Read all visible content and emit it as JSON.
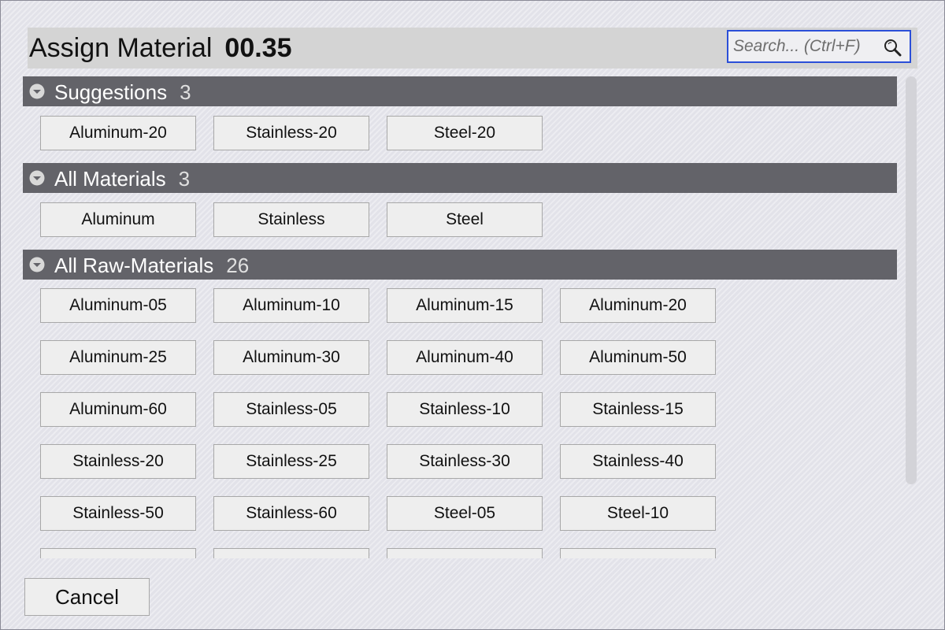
{
  "dialog": {
    "title": "Assign Material",
    "value": "00.35"
  },
  "search": {
    "placeholder": "Search... (Ctrl+F)",
    "icon": "magnifier-icon"
  },
  "sections": {
    "suggestions": {
      "label": "Suggestions",
      "count": "3",
      "items": [
        "Aluminum-20",
        "Stainless-20",
        "Steel-20"
      ]
    },
    "all_materials": {
      "label": "All Materials",
      "count": "3",
      "items": [
        "Aluminum",
        "Stainless",
        "Steel"
      ]
    },
    "all_raw_materials": {
      "label": "All Raw-Materials",
      "count": "26",
      "items": [
        "Aluminum-05",
        "Aluminum-10",
        "Aluminum-15",
        "Aluminum-20",
        "Aluminum-25",
        "Aluminum-30",
        "Aluminum-40",
        "Aluminum-50",
        "Aluminum-60",
        "Stainless-05",
        "Stainless-10",
        "Stainless-15",
        "Stainless-20",
        "Stainless-25",
        "Stainless-30",
        "Stainless-40",
        "Stainless-50",
        "Stainless-60",
        "Steel-05",
        "Steel-10"
      ]
    }
  },
  "footer": {
    "cancel_label": "Cancel"
  },
  "colors": {
    "section_header": "#636369",
    "search_border": "#2b4fd8",
    "tile_bg": "#eeeeee"
  }
}
